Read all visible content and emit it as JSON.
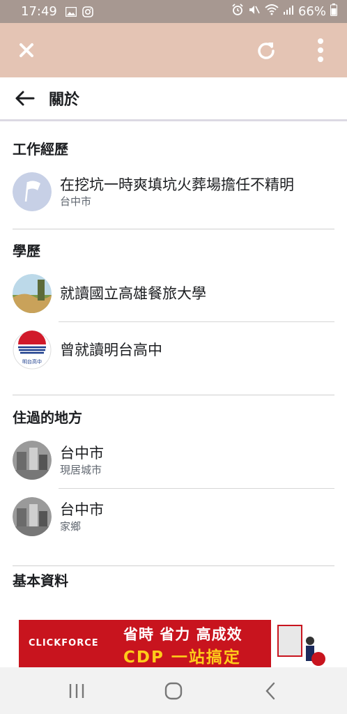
{
  "status_bar": {
    "time": "17:49",
    "battery": "66%"
  },
  "header": {
    "title": "關於"
  },
  "sections": {
    "work": {
      "heading": "工作經歷",
      "items": [
        {
          "primary": "在挖坑一時爽填坑火葬場擔任不精明",
          "secondary": "台中市"
        }
      ]
    },
    "education": {
      "heading": "學歷",
      "items": [
        {
          "primary": "就讀國立高雄餐旅大學"
        },
        {
          "primary": "曾就讀明台高中"
        }
      ]
    },
    "places": {
      "heading": "住過的地方",
      "items": [
        {
          "primary": "台中市",
          "secondary": "現居城市"
        },
        {
          "primary": "台中市",
          "secondary": "家鄉"
        }
      ]
    },
    "basic": {
      "heading": "基本資料"
    }
  },
  "ad": {
    "brand": "CLICKFORCE",
    "line1": "省時 省力 高成效",
    "line2": "CDP 一站搞定"
  },
  "colors": {
    "status_bar": "#a79891",
    "app_bar": "#e4c4b4",
    "ad_background": "#c8141e",
    "ad_highlight": "#ffcc1a"
  }
}
